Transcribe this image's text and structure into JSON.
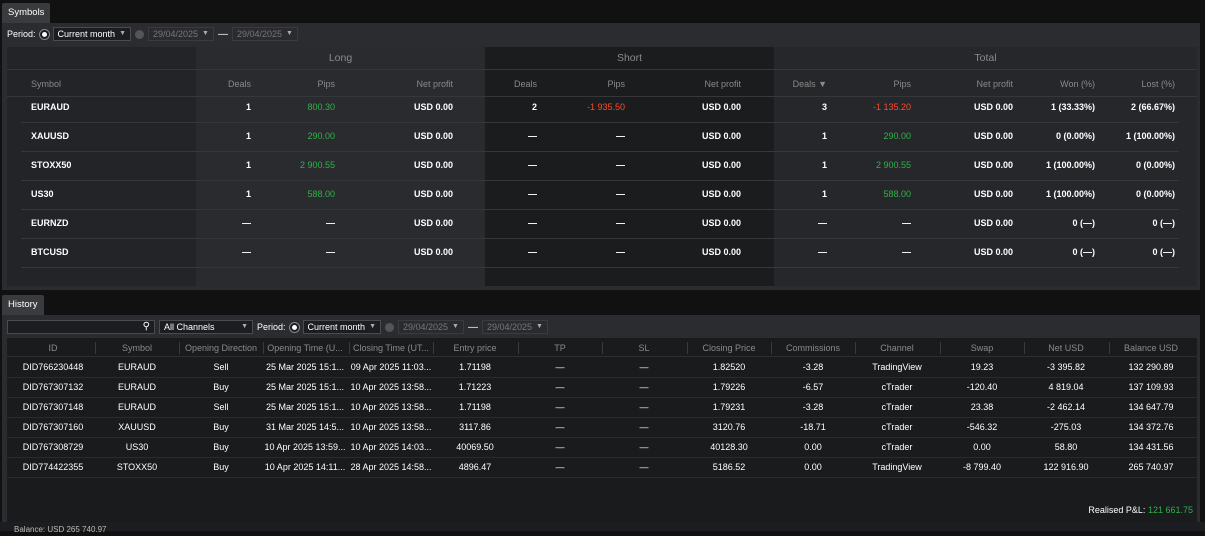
{
  "symbols_tab": "Symbols",
  "history_tab": "History",
  "symbols_filter": {
    "period_label": "Period:",
    "period_value": "Current month",
    "date_from": "29/04/2025",
    "date_to": "29/04/2025"
  },
  "groups": {
    "long": "Long",
    "short": "Short",
    "total": "Total"
  },
  "sym_headers": {
    "symbol": "Symbol",
    "long_deals": "Deals",
    "long_pips": "Pips",
    "long_np": "Net profit",
    "short_deals": "Deals",
    "short_pips": "Pips",
    "short_np": "Net profit",
    "total_deals": "Deals ▼",
    "total_pips": "Pips",
    "total_np": "Net profit",
    "won": "Won (%)",
    "lost": "Lost (%)"
  },
  "symbols_rows": [
    {
      "symbol": "EURAUD",
      "ld": "1",
      "lp": "800.30",
      "lpc": "green",
      "lnp": "USD 0.00",
      "sd": "2",
      "sp": "-1 935.50",
      "spc": "red",
      "snp": "USD 0.00",
      "td": "3",
      "tp": "-1 135.20",
      "tpc": "red",
      "tnp": "USD 0.00",
      "won": "1 (33.33%)",
      "lost": "2 (66.67%)"
    },
    {
      "symbol": "XAUUSD",
      "ld": "1",
      "lp": "290.00",
      "lpc": "green",
      "lnp": "USD 0.00",
      "sd": "—",
      "sp": "—",
      "spc": "white",
      "snp": "USD 0.00",
      "td": "1",
      "tp": "290.00",
      "tpc": "green",
      "tnp": "USD 0.00",
      "won": "0 (0.00%)",
      "lost": "1 (100.00%)"
    },
    {
      "symbol": "STOXX50",
      "ld": "1",
      "lp": "2 900.55",
      "lpc": "green",
      "lnp": "USD 0.00",
      "sd": "—",
      "sp": "—",
      "spc": "white",
      "snp": "USD 0.00",
      "td": "1",
      "tp": "2 900.55",
      "tpc": "green",
      "tnp": "USD 0.00",
      "won": "1 (100.00%)",
      "lost": "0 (0.00%)"
    },
    {
      "symbol": "US30",
      "ld": "1",
      "lp": "588.00",
      "lpc": "green",
      "lnp": "USD 0.00",
      "sd": "—",
      "sp": "—",
      "spc": "white",
      "snp": "USD 0.00",
      "td": "1",
      "tp": "588.00",
      "tpc": "green",
      "tnp": "USD 0.00",
      "won": "1 (100.00%)",
      "lost": "0 (0.00%)"
    },
    {
      "symbol": "EURNZD",
      "ld": "—",
      "lp": "—",
      "lpc": "white",
      "lnp": "USD 0.00",
      "sd": "—",
      "sp": "—",
      "spc": "white",
      "snp": "USD 0.00",
      "td": "—",
      "tp": "—",
      "tpc": "white",
      "tnp": "USD 0.00",
      "won": "0 (—)",
      "lost": "0 (—)"
    },
    {
      "symbol": "BTCUSD",
      "ld": "—",
      "lp": "—",
      "lpc": "white",
      "lnp": "USD 0.00",
      "sd": "—",
      "sp": "—",
      "spc": "white",
      "snp": "USD 0.00",
      "td": "—",
      "tp": "—",
      "tpc": "white",
      "tnp": "USD 0.00",
      "won": "0 (—)",
      "lost": "0 (—)"
    }
  ],
  "history_filter": {
    "search_placeholder": "",
    "channel_value": "All Channels",
    "period_label": "Period:",
    "period_value": "Current month",
    "date_from": "29/04/2025",
    "date_to": "29/04/2025"
  },
  "hist_headers": [
    "ID",
    "Symbol",
    "Opening Direction",
    "Opening Time (U...",
    "Closing Time (UT...",
    "Entry price",
    "TP",
    "SL",
    "Closing Price",
    "Commissions",
    "Channel",
    "Swap",
    "Net USD",
    "Balance USD"
  ],
  "history_rows": [
    {
      "id": "DID766230448",
      "symbol": "EURAUD",
      "dir": "Sell",
      "open": "25 Mar 2025 15:1...",
      "close": "09 Apr 2025 11:03...",
      "entry": "1.71198",
      "tp": "—",
      "sl": "—",
      "closep": "1.82520",
      "comm": "-3.28",
      "channel": "TradingView",
      "swap": "19.23",
      "net": "-3 395.82",
      "netc": "red",
      "bal": "132 290.89"
    },
    {
      "id": "DID767307132",
      "symbol": "EURAUD",
      "dir": "Buy",
      "open": "25 Mar 2025 15:1...",
      "close": "10 Apr 2025 13:58...",
      "entry": "1.71223",
      "tp": "—",
      "sl": "—",
      "closep": "1.79226",
      "comm": "-6.57",
      "channel": "cTrader",
      "swap": "-120.40",
      "net": "4 819.04",
      "netc": "green",
      "bal": "137 109.93"
    },
    {
      "id": "DID767307148",
      "symbol": "EURAUD",
      "dir": "Sell",
      "open": "25 Mar 2025 15:1...",
      "close": "10 Apr 2025 13:58...",
      "entry": "1.71198",
      "tp": "—",
      "sl": "—",
      "closep": "1.79231",
      "comm": "-3.28",
      "channel": "cTrader",
      "swap": "23.38",
      "net": "-2 462.14",
      "netc": "red",
      "bal": "134 647.79"
    },
    {
      "id": "DID767307160",
      "symbol": "XAUUSD",
      "dir": "Buy",
      "open": "31 Mar 2025 14:5...",
      "close": "10 Apr 2025 13:58...",
      "entry": "3117.86",
      "tp": "—",
      "sl": "—",
      "closep": "3120.76",
      "comm": "-18.71",
      "channel": "cTrader",
      "swap": "-546.32",
      "net": "-275.03",
      "netc": "red",
      "bal": "134 372.76"
    },
    {
      "id": "DID767308729",
      "symbol": "US30",
      "dir": "Buy",
      "open": "10 Apr 2025 13:59...",
      "close": "10 Apr 2025 14:03...",
      "entry": "40069.50",
      "tp": "—",
      "sl": "—",
      "closep": "40128.30",
      "comm": "0.00",
      "channel": "cTrader",
      "swap": "0.00",
      "net": "58.80",
      "netc": "green",
      "bal": "134 431.56"
    },
    {
      "id": "DID774422355",
      "symbol": "STOXX50",
      "dir": "Buy",
      "open": "10 Apr 2025 14:11...",
      "close": "28 Apr 2025 14:58...",
      "entry": "4896.47",
      "tp": "—",
      "sl": "—",
      "closep": "5186.52",
      "comm": "0.00",
      "channel": "TradingView",
      "swap": "-8 799.40",
      "net": "122 916.90",
      "netc": "green",
      "bal": "265 740.97"
    }
  ],
  "realised_label": "Realised P&L:",
  "realised_value": "121 661.75",
  "balance_footer": "Balance: USD 265 740.97",
  "colors": {
    "positive": "#2db34a",
    "negative": "#ff4a2a",
    "panel": "#2b2c2f"
  }
}
